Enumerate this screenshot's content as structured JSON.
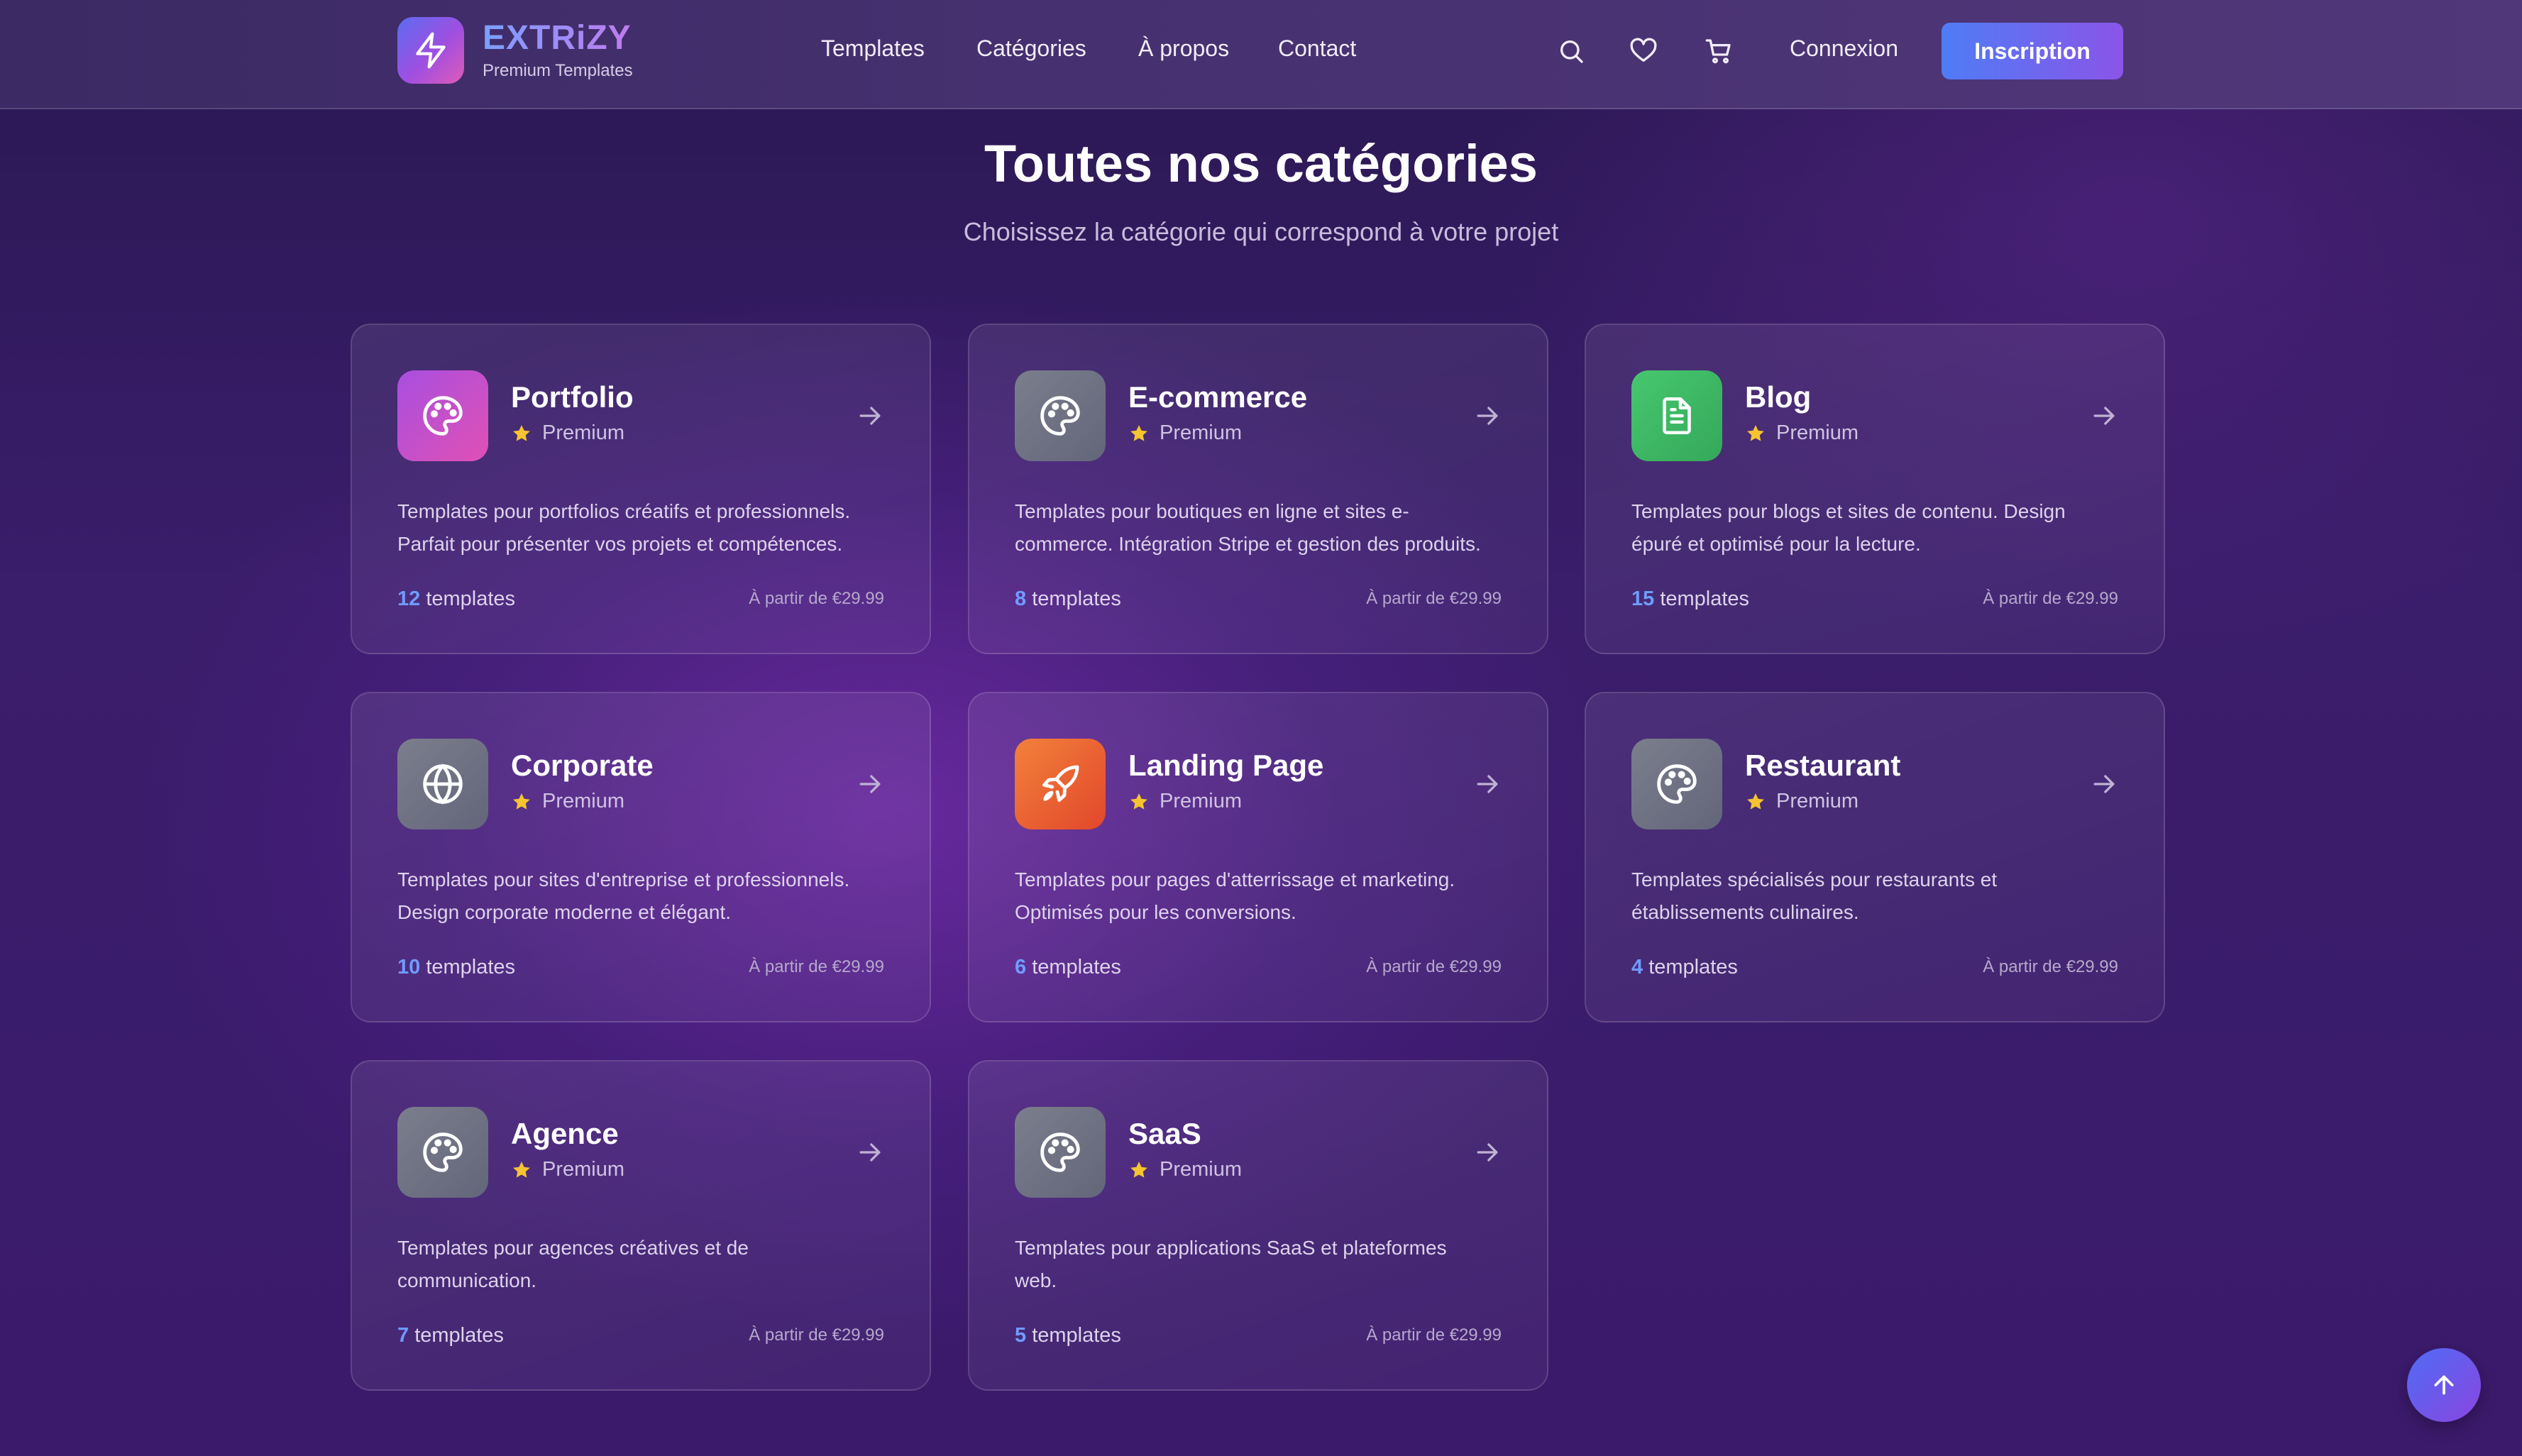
{
  "header": {
    "brand": "EXTRiZY",
    "tagline": "Premium Templates",
    "nav": [
      "Templates",
      "Catégories",
      "À propos",
      "Contact"
    ],
    "login_label": "Connexion",
    "signup_label": "Inscription"
  },
  "page": {
    "title": "Toutes nos catégories",
    "subtitle": "Choisissez la catégorie qui correspond à votre projet"
  },
  "colors": {
    "accent": "#4f7cf5",
    "count": "#6f9cff",
    "star": "#f5c430",
    "portfolio_icon": "#c34fd6",
    "gray_icon": "#6f7280",
    "blog_icon": "#3fbf6a",
    "landing_icon": "#ef6a32"
  },
  "categories": [
    {
      "name": "Portfolio",
      "badge": "Premium",
      "icon": "palette-icon",
      "icon_color": "#c34fd6",
      "desc_line1": "Templates pour portfolios créatifs et professionnels.",
      "desc_line2": "Parfait pour présenter vos projets et compétences.",
      "count": "12",
      "count_label": "templates",
      "price": "À partir de €29.99"
    },
    {
      "name": "E-commerce",
      "badge": "Premium",
      "icon": "palette-icon",
      "icon_color": "#6f7280",
      "desc_line1": "Templates pour boutiques en ligne et sites e-",
      "desc_line2": "commerce. Intégration Stripe et gestion des produits.",
      "count": "8",
      "count_label": "templates",
      "price": "À partir de €29.99"
    },
    {
      "name": "Blog",
      "badge": "Premium",
      "icon": "document-icon",
      "icon_color": "#3fbf6a",
      "desc_line1": "Templates pour blogs et sites de contenu. Design",
      "desc_line2": "épuré et optimisé pour la lecture.",
      "count": "15",
      "count_label": "templates",
      "price": "À partir de €29.99"
    },
    {
      "name": "Corporate",
      "badge": "Premium",
      "icon": "globe-icon",
      "icon_color": "#6f7280",
      "desc_line1": "Templates pour sites d'entreprise et professionnels.",
      "desc_line2": "Design corporate moderne et élégant.",
      "count": "10",
      "count_label": "templates",
      "price": "À partir de €29.99"
    },
    {
      "name": "Landing Page",
      "badge": "Premium",
      "icon": "rocket-icon",
      "icon_color": "#ef6a32",
      "desc_line1": "Templates pour pages d'atterrissage et marketing.",
      "desc_line2": "Optimisés pour les conversions.",
      "count": "6",
      "count_label": "templates",
      "price": "À partir de €29.99"
    },
    {
      "name": "Restaurant",
      "badge": "Premium",
      "icon": "palette-icon",
      "icon_color": "#6f7280",
      "desc_line1": "Templates spécialisés pour restaurants et",
      "desc_line2": "établissements culinaires.",
      "count": "4",
      "count_label": "templates",
      "price": "À partir de €29.99"
    },
    {
      "name": "Agence",
      "badge": "Premium",
      "icon": "palette-icon",
      "icon_color": "#6f7280",
      "desc_line1": "Templates pour agences créatives et de",
      "desc_line2": "communication.",
      "count": "7",
      "count_label": "templates",
      "price": "À partir de €29.99"
    },
    {
      "name": "SaaS",
      "badge": "Premium",
      "icon": "palette-icon",
      "icon_color": "#6f7280",
      "desc_line1": "Templates pour applications SaaS et plateformes",
      "desc_line2": "web.",
      "count": "5",
      "count_label": "templates",
      "price": "À partir de €29.99"
    }
  ]
}
